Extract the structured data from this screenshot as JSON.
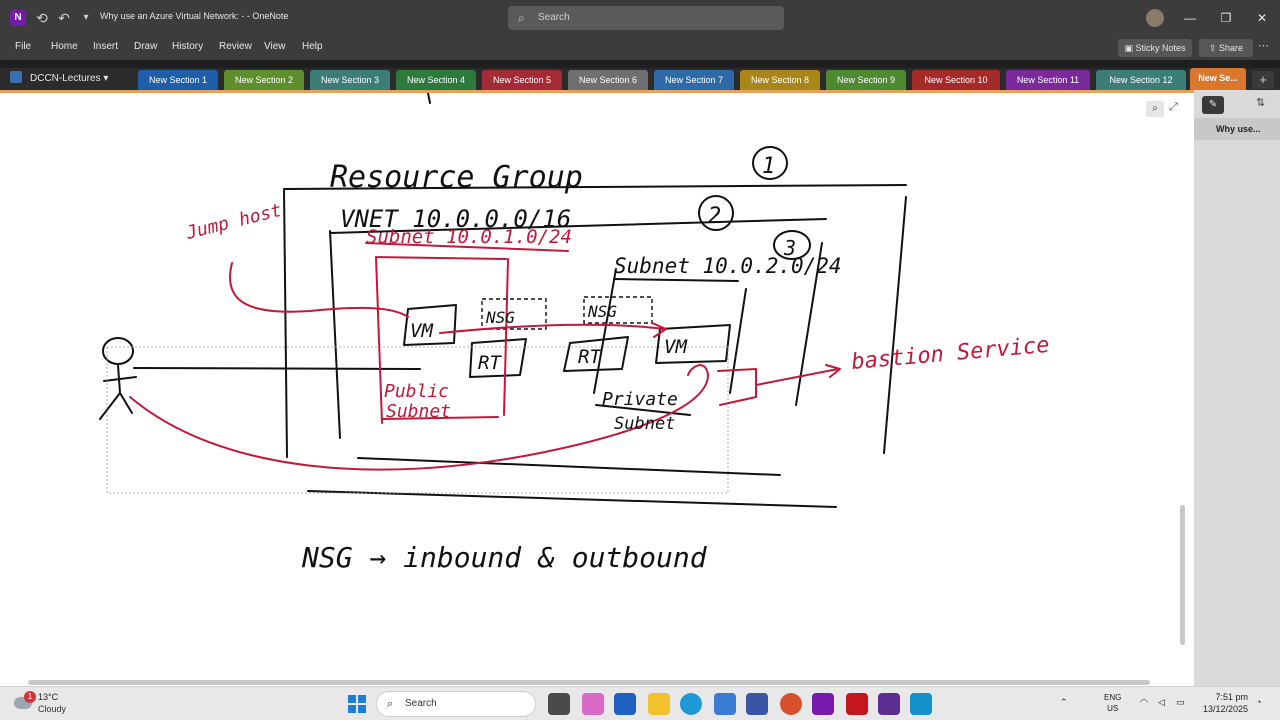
{
  "titlebar": {
    "app_icon": "N",
    "doc_title": "Why use an Azure Virtual Network: -  -  OneNote",
    "search_placeholder": "Search",
    "icons": [
      "back-icon",
      "undo-icon",
      "customize-icon",
      "search-icon",
      "minimize-icon",
      "restore-icon",
      "close-icon"
    ]
  },
  "menu": {
    "items": [
      "File",
      "Home",
      "Insert",
      "Draw",
      "History",
      "Review",
      "View",
      "Help"
    ],
    "sticky_notes": "Sticky Notes",
    "share": "Share"
  },
  "notebook": {
    "name": "DCCN-Lectures"
  },
  "sections": [
    {
      "label": "New Section 1",
      "color": "#1e5ea8"
    },
    {
      "label": "New Section 2",
      "color": "#5f8f2c"
    },
    {
      "label": "New Section 3",
      "color": "#3c7d78"
    },
    {
      "label": "New Section 4",
      "color": "#2e7a3c"
    },
    {
      "label": "New Section 5",
      "color": "#a32b35"
    },
    {
      "label": "New Section 6",
      "color": "#6f6f6f"
    },
    {
      "label": "New Section 7",
      "color": "#2f6aa8"
    },
    {
      "label": "New Section 8",
      "color": "#a9861a"
    },
    {
      "label": "New Section 9",
      "color": "#4d8a32"
    },
    {
      "label": "New Section 10",
      "color": "#a52a2a"
    },
    {
      "label": "New Section 11",
      "color": "#7a2a9a"
    },
    {
      "label": "New Section 12",
      "color": "#3c7d78"
    },
    {
      "label": "New Se...",
      "color": "#d9782d"
    }
  ],
  "pages": {
    "current": "Why use..."
  },
  "ink": {
    "resource_group": "Resource Group",
    "num1": "1",
    "vnet": "VNET 10.0.0.0/16",
    "num2": "2",
    "num3": "3",
    "subnet1": "Subnet 10.0.1.0/24",
    "subnet2": "Subnet 10.0.2.0/24",
    "jump_host": "Jump host",
    "vm1": "VM",
    "vm2": "VM",
    "nsg1": "NSG",
    "nsg2": "NSG",
    "rt1": "RT",
    "rt2": "RT",
    "public_subnet_1": "Public",
    "public_subnet_2": "Subnet",
    "private_subnet_1": "Private",
    "private_subnet_2": "Subnet",
    "bastion": "bastion Service",
    "nsg_note": "NSG → inbound & outbound"
  },
  "colors": {
    "ink_black": "#111111",
    "ink_red": "#c0193a",
    "accent_orange": "#e8a15c"
  },
  "taskbar": {
    "temp": "13°C",
    "condition": "Cloudy",
    "weather_badge": "1",
    "search": "Search",
    "lang1": "ENG",
    "lang2": "US",
    "time": "7:51 pm",
    "date": "13/12/2025"
  }
}
